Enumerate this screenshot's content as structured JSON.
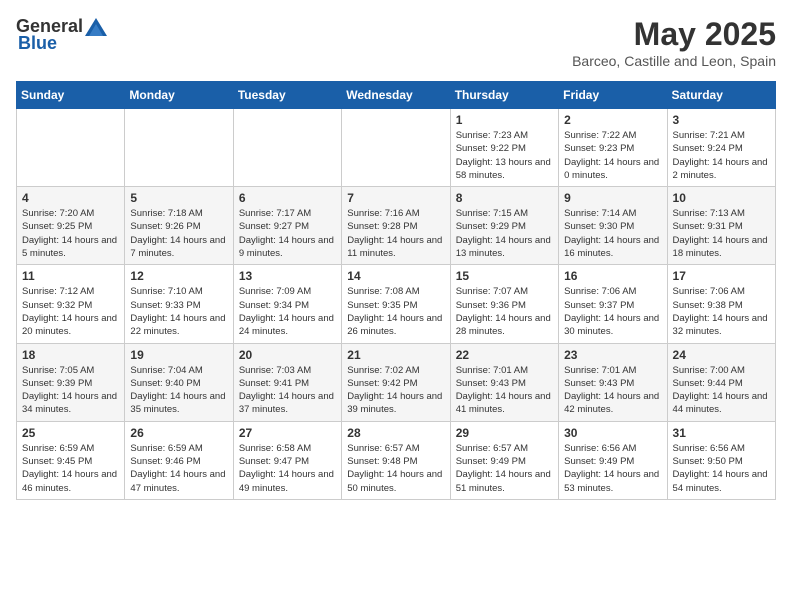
{
  "header": {
    "logo_general": "General",
    "logo_blue": "Blue",
    "title": "May 2025",
    "location": "Barceo, Castille and Leon, Spain"
  },
  "weekdays": [
    "Sunday",
    "Monday",
    "Tuesday",
    "Wednesday",
    "Thursday",
    "Friday",
    "Saturday"
  ],
  "weeks": [
    [
      {
        "day": "",
        "info": ""
      },
      {
        "day": "",
        "info": ""
      },
      {
        "day": "",
        "info": ""
      },
      {
        "day": "",
        "info": ""
      },
      {
        "day": "1",
        "info": "Sunrise: 7:23 AM\nSunset: 9:22 PM\nDaylight: 13 hours and 58 minutes."
      },
      {
        "day": "2",
        "info": "Sunrise: 7:22 AM\nSunset: 9:23 PM\nDaylight: 14 hours and 0 minutes."
      },
      {
        "day": "3",
        "info": "Sunrise: 7:21 AM\nSunset: 9:24 PM\nDaylight: 14 hours and 2 minutes."
      }
    ],
    [
      {
        "day": "4",
        "info": "Sunrise: 7:20 AM\nSunset: 9:25 PM\nDaylight: 14 hours and 5 minutes."
      },
      {
        "day": "5",
        "info": "Sunrise: 7:18 AM\nSunset: 9:26 PM\nDaylight: 14 hours and 7 minutes."
      },
      {
        "day": "6",
        "info": "Sunrise: 7:17 AM\nSunset: 9:27 PM\nDaylight: 14 hours and 9 minutes."
      },
      {
        "day": "7",
        "info": "Sunrise: 7:16 AM\nSunset: 9:28 PM\nDaylight: 14 hours and 11 minutes."
      },
      {
        "day": "8",
        "info": "Sunrise: 7:15 AM\nSunset: 9:29 PM\nDaylight: 14 hours and 13 minutes."
      },
      {
        "day": "9",
        "info": "Sunrise: 7:14 AM\nSunset: 9:30 PM\nDaylight: 14 hours and 16 minutes."
      },
      {
        "day": "10",
        "info": "Sunrise: 7:13 AM\nSunset: 9:31 PM\nDaylight: 14 hours and 18 minutes."
      }
    ],
    [
      {
        "day": "11",
        "info": "Sunrise: 7:12 AM\nSunset: 9:32 PM\nDaylight: 14 hours and 20 minutes."
      },
      {
        "day": "12",
        "info": "Sunrise: 7:10 AM\nSunset: 9:33 PM\nDaylight: 14 hours and 22 minutes."
      },
      {
        "day": "13",
        "info": "Sunrise: 7:09 AM\nSunset: 9:34 PM\nDaylight: 14 hours and 24 minutes."
      },
      {
        "day": "14",
        "info": "Sunrise: 7:08 AM\nSunset: 9:35 PM\nDaylight: 14 hours and 26 minutes."
      },
      {
        "day": "15",
        "info": "Sunrise: 7:07 AM\nSunset: 9:36 PM\nDaylight: 14 hours and 28 minutes."
      },
      {
        "day": "16",
        "info": "Sunrise: 7:06 AM\nSunset: 9:37 PM\nDaylight: 14 hours and 30 minutes."
      },
      {
        "day": "17",
        "info": "Sunrise: 7:06 AM\nSunset: 9:38 PM\nDaylight: 14 hours and 32 minutes."
      }
    ],
    [
      {
        "day": "18",
        "info": "Sunrise: 7:05 AM\nSunset: 9:39 PM\nDaylight: 14 hours and 34 minutes."
      },
      {
        "day": "19",
        "info": "Sunrise: 7:04 AM\nSunset: 9:40 PM\nDaylight: 14 hours and 35 minutes."
      },
      {
        "day": "20",
        "info": "Sunrise: 7:03 AM\nSunset: 9:41 PM\nDaylight: 14 hours and 37 minutes."
      },
      {
        "day": "21",
        "info": "Sunrise: 7:02 AM\nSunset: 9:42 PM\nDaylight: 14 hours and 39 minutes."
      },
      {
        "day": "22",
        "info": "Sunrise: 7:01 AM\nSunset: 9:43 PM\nDaylight: 14 hours and 41 minutes."
      },
      {
        "day": "23",
        "info": "Sunrise: 7:01 AM\nSunset: 9:43 PM\nDaylight: 14 hours and 42 minutes."
      },
      {
        "day": "24",
        "info": "Sunrise: 7:00 AM\nSunset: 9:44 PM\nDaylight: 14 hours and 44 minutes."
      }
    ],
    [
      {
        "day": "25",
        "info": "Sunrise: 6:59 AM\nSunset: 9:45 PM\nDaylight: 14 hours and 46 minutes."
      },
      {
        "day": "26",
        "info": "Sunrise: 6:59 AM\nSunset: 9:46 PM\nDaylight: 14 hours and 47 minutes."
      },
      {
        "day": "27",
        "info": "Sunrise: 6:58 AM\nSunset: 9:47 PM\nDaylight: 14 hours and 49 minutes."
      },
      {
        "day": "28",
        "info": "Sunrise: 6:57 AM\nSunset: 9:48 PM\nDaylight: 14 hours and 50 minutes."
      },
      {
        "day": "29",
        "info": "Sunrise: 6:57 AM\nSunset: 9:49 PM\nDaylight: 14 hours and 51 minutes."
      },
      {
        "day": "30",
        "info": "Sunrise: 6:56 AM\nSunset: 9:49 PM\nDaylight: 14 hours and 53 minutes."
      },
      {
        "day": "31",
        "info": "Sunrise: 6:56 AM\nSunset: 9:50 PM\nDaylight: 14 hours and 54 minutes."
      }
    ]
  ]
}
